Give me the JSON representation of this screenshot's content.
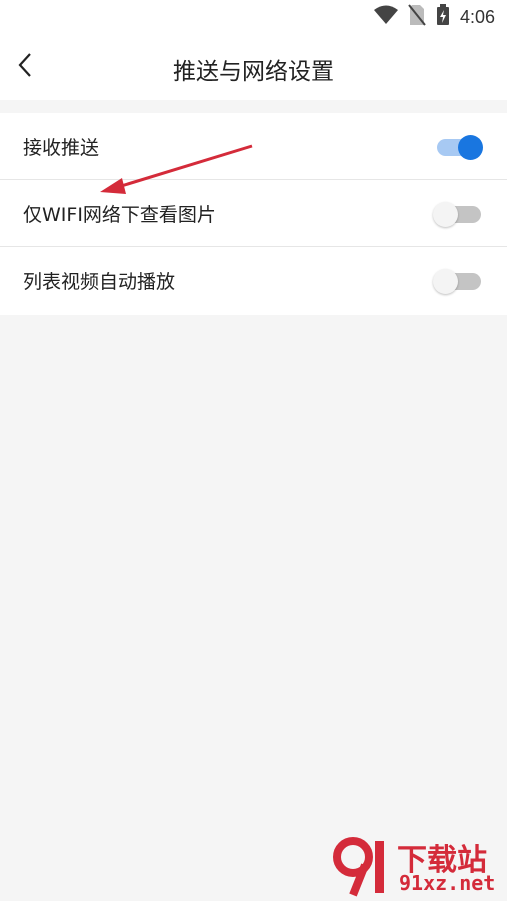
{
  "status_bar": {
    "time": "4:06",
    "icons": [
      "wifi-icon",
      "no-sim-icon",
      "battery-charging-icon"
    ]
  },
  "header": {
    "title": "推送与网络设置",
    "back_icon": "chevron-left-icon"
  },
  "settings": [
    {
      "label": "接收推送",
      "enabled": true
    },
    {
      "label": "仅WIFI网络下查看图片",
      "enabled": false
    },
    {
      "label": "列表视频自动播放",
      "enabled": false
    }
  ],
  "colors": {
    "accent": "#1976e0",
    "accent_track": "#a7c9f3",
    "annotation_arrow": "#d42b3a"
  },
  "watermark": {
    "top_text": "下载站",
    "bottom_text": "91xz.net"
  }
}
